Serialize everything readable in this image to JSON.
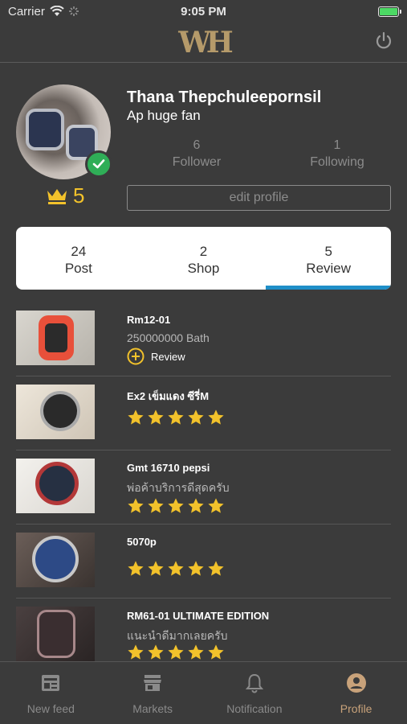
{
  "status_bar": {
    "carrier": "Carrier",
    "time": "9:05 PM"
  },
  "header": {
    "logo": "WH"
  },
  "profile": {
    "name": "Thana Thepchuleepornsil",
    "bio": "Ap huge fan",
    "crown_count": "5",
    "follower": {
      "count": "6",
      "label": "Follower"
    },
    "following": {
      "count": "1",
      "label": "Following"
    },
    "edit_label": "edit profile"
  },
  "tabs": [
    {
      "count": "24",
      "label": "Post"
    },
    {
      "count": "2",
      "label": "Shop"
    },
    {
      "count": "5",
      "label": "Review"
    }
  ],
  "items": [
    {
      "title": "Rm12-01",
      "subtitle": "250000000 Bath",
      "review_label": "Review",
      "rating": 0
    },
    {
      "title": "Ex2 เข็มแดง ซีรี่M",
      "subtitle": "",
      "rating": 5
    },
    {
      "title": "Gmt 16710 pepsi",
      "subtitle": "พ่อค้าบริการดีสุดครับ",
      "rating": 5
    },
    {
      "title": "5070p",
      "subtitle": "",
      "rating": 5
    },
    {
      "title": "RM61-01 ULTIMATE EDITION",
      "subtitle": "แนะนำดีมากเลยครับ",
      "rating": 5
    }
  ],
  "bottom_nav": [
    {
      "label": "New feed"
    },
    {
      "label": "Markets"
    },
    {
      "label": "Notification"
    },
    {
      "label": "Profile"
    }
  ],
  "colors": {
    "background": "#3b3b3b",
    "accent_gold": "#f2c22b",
    "tab_indicator": "#1f8fc8",
    "active_nav": "#c8a27a"
  }
}
